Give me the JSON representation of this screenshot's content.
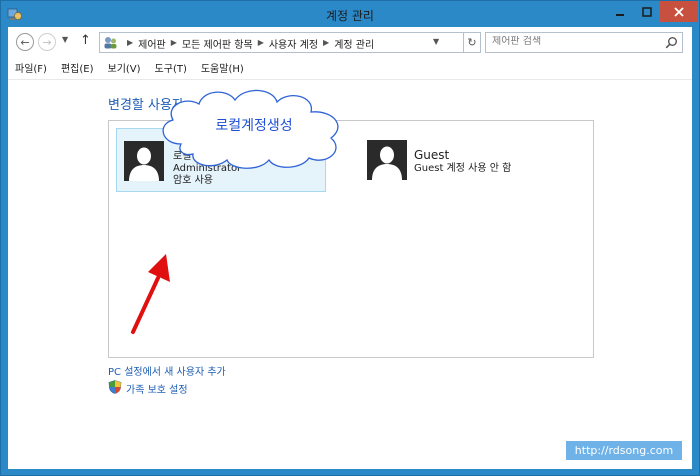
{
  "window": {
    "title": "계정 관리"
  },
  "address": {
    "crumbs": [
      "제어판",
      "모든 제어판 항목",
      "사용자 계정",
      "계정 관리"
    ]
  },
  "search": {
    "placeholder": "제어판 검색"
  },
  "menu": {
    "items": [
      "파일(F)",
      "편집(E)",
      "보기(V)",
      "도구(T)",
      "도움말(H)"
    ]
  },
  "main": {
    "heading": "변경할 사용자",
    "accounts": [
      {
        "name": "로컬 계정",
        "line2": "Administrator",
        "line3": "암호 사용"
      },
      {
        "name": "Guest",
        "line2": "Guest 계정 사용 안 함"
      }
    ],
    "links": {
      "add_user": "PC 설정에서 새 사용자 추가",
      "family": "가족 보호 설정"
    }
  },
  "annotation": {
    "cloud_text": "로컬계정생성"
  },
  "watermark": "http://rdsong.com",
  "colors": {
    "window_frame": "#2b89c8",
    "link": "#1e5eb4",
    "close": "#c7503f",
    "selected": "#e5f3fb",
    "arrow": "#e01010"
  }
}
